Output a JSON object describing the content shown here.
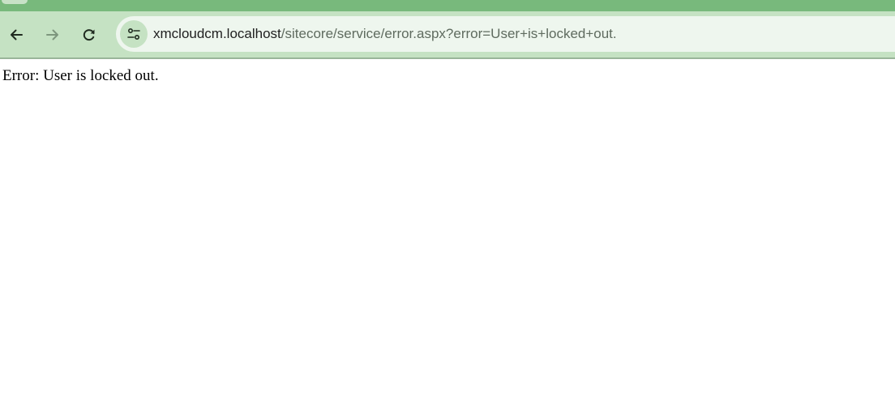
{
  "browser": {
    "url_host": "xmcloudcm.localhost",
    "url_path": "/sitecore/service/error.aspx?error=User+is+locked+out.",
    "icons": {
      "back": "arrow-left-icon",
      "forward": "arrow-right-icon",
      "reload": "reload-icon",
      "site_info": "site-settings-icon"
    },
    "colors": {
      "toolbar": "#c5e2c3",
      "tabstrip": "#78b97c",
      "omnibox": "#eef6ee"
    }
  },
  "page": {
    "message": "Error: User is locked out."
  }
}
